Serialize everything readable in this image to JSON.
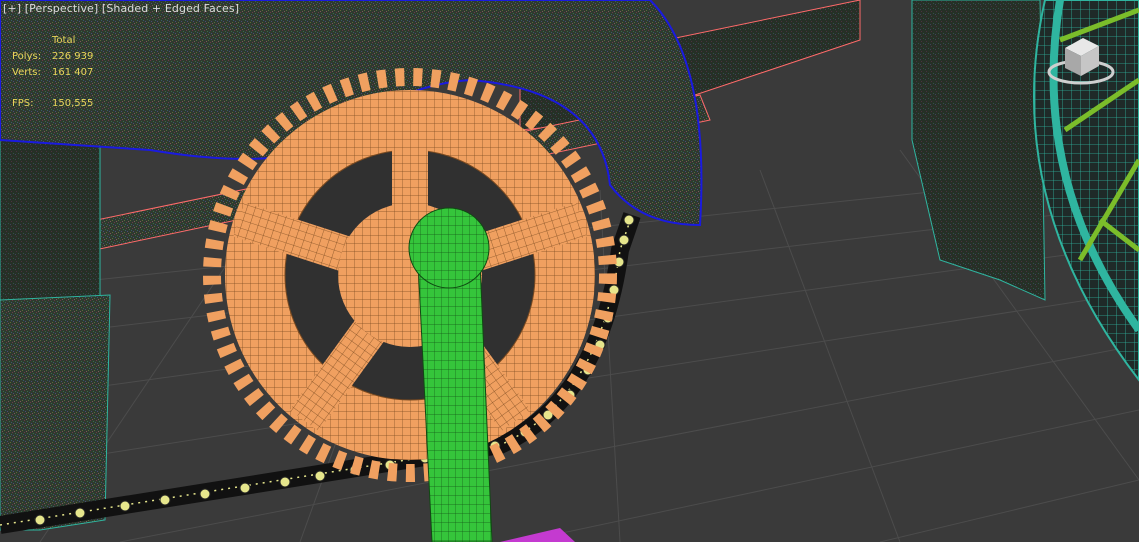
{
  "viewport": {
    "menu_label": "[+]",
    "view_label": "[Perspective]",
    "shading_label": "[Shaded + Edged Faces]"
  },
  "stats": {
    "header": "Total",
    "polys_label": "Polys:",
    "polys_value": "226 939",
    "verts_label": "Verts:",
    "verts_value": "161 407",
    "fps_label": "FPS:",
    "fps_value": "150,555"
  },
  "colors": {
    "background": "#3a3a3a",
    "grid": "#4a4a4a",
    "stats_text": "#e8d65a",
    "sprocket": "#f0a060",
    "crank": "#35c53b",
    "chain": "#e6e68c",
    "wheel": "#2fb5a0",
    "spokes": "#7bbd2a",
    "fender_edge": "#1a1ae0",
    "frame_edge": "#ff6a6a"
  },
  "icons": {
    "viewcube": "viewcube-icon"
  }
}
